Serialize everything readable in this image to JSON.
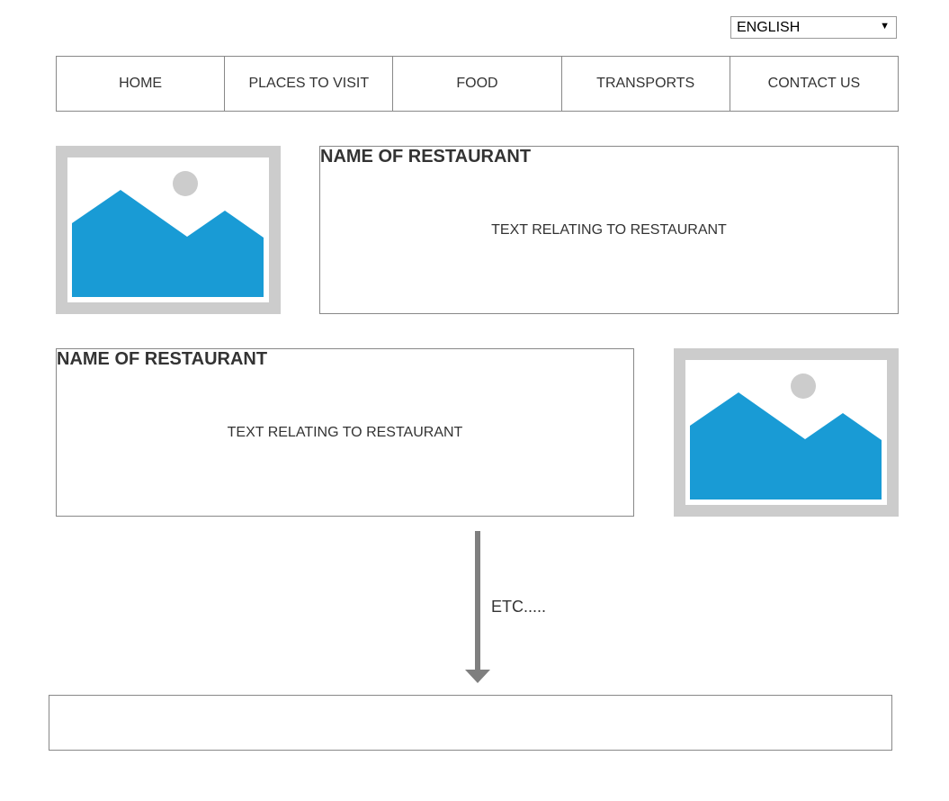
{
  "language_select": {
    "value": "ENGLISH"
  },
  "nav": {
    "items": [
      "HOME",
      "PLACES TO VISIT",
      "FOOD",
      "TRANSPORTS",
      "CONTACT US"
    ]
  },
  "restaurants": [
    {
      "name": "NAME OF RESTAURANT",
      "text": "TEXT RELATING TO RESTAURANT",
      "image_position": "left"
    },
    {
      "name": "NAME OF RESTAURANT",
      "text": "TEXT RELATING TO RESTAURANT",
      "image_position": "right"
    }
  ],
  "continuation": {
    "label": "ETC....."
  },
  "colors": {
    "image_frame": "#cccccc",
    "image_mountain": "#199bd5",
    "border": "#888888",
    "arrow": "#7f7f7f"
  }
}
